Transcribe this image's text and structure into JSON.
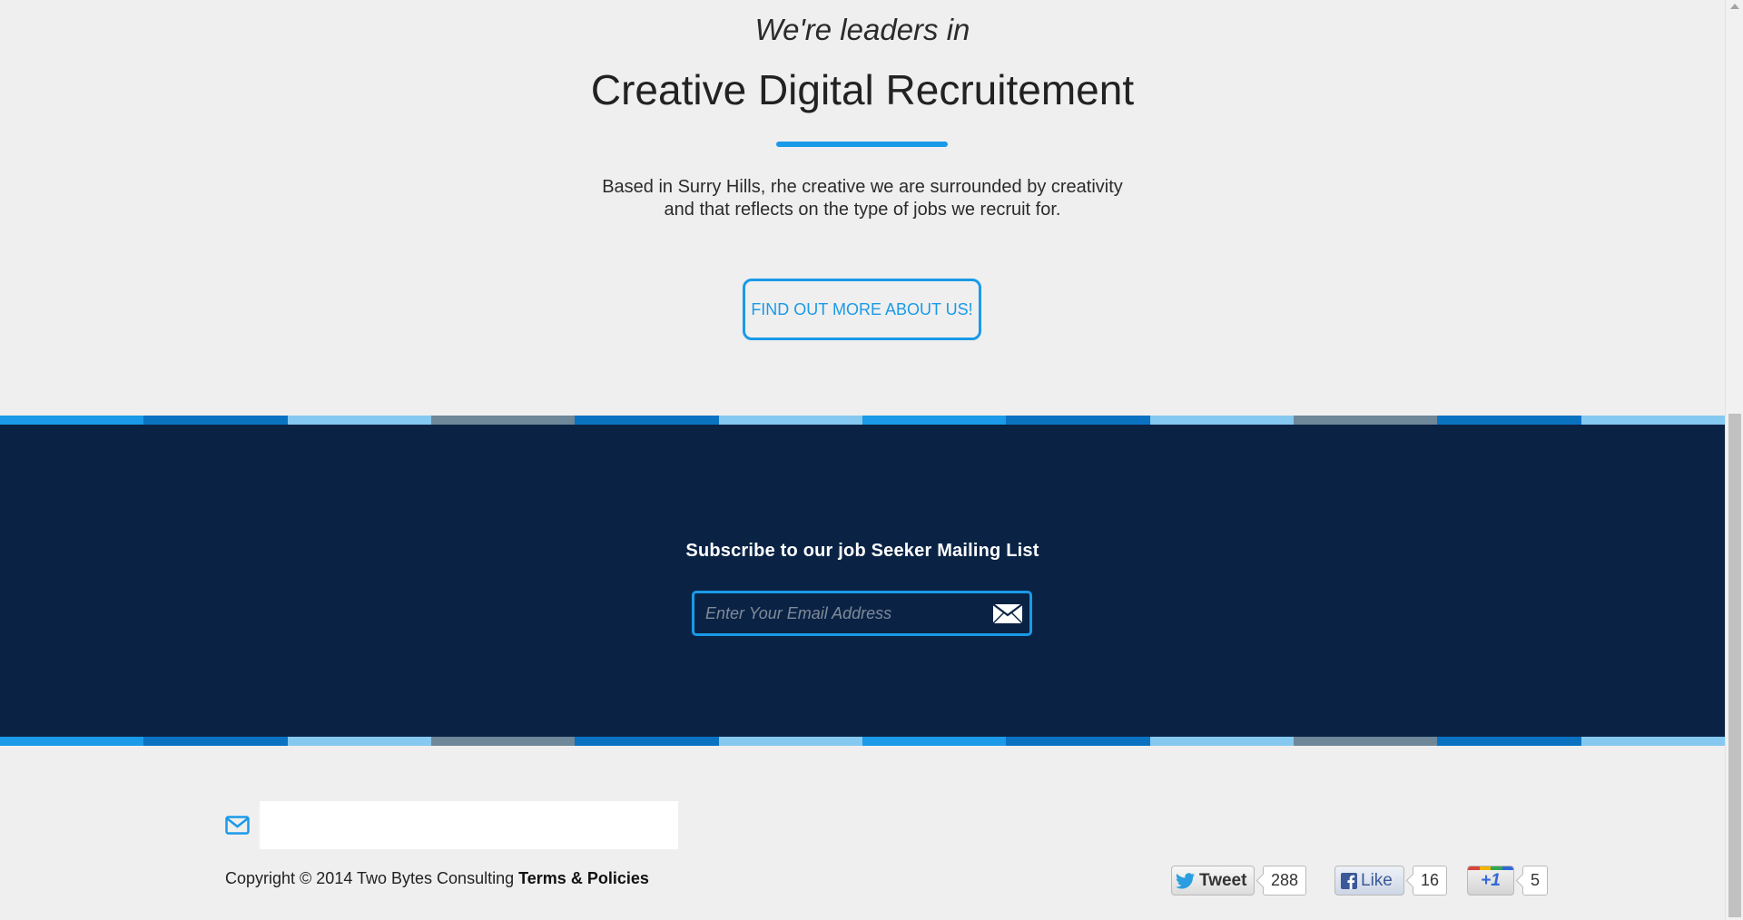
{
  "intro": {
    "kicker": "We're leaders in",
    "title": "Creative Digital Recruitement",
    "text_line1": "Based in Surry Hills, rhe creative we are surrounded by creativity",
    "text_line2": "and that reflects on the type of jobs we recruit for.",
    "cta_label": "FIND OUT MORE ABOUT US!"
  },
  "stripe_colors": [
    "#1a9ae8",
    "#0b72c2",
    "#85c8f0",
    "#6e8799",
    "#0b72c2",
    "#85c8f0",
    "#1a9ae8",
    "#0b72c2",
    "#85c8f0",
    "#6e8799",
    "#0b72c2",
    "#85c8f0"
  ],
  "subscribe": {
    "title": "Subscribe to our job Seeker Mailing List",
    "email_value": "",
    "email_placeholder": "Enter Your Email Address",
    "submit_icon": "envelope-icon"
  },
  "footer": {
    "mail_icon": "envelope-outline-icon",
    "copyright": "Copyright © 2014 Two Bytes Consulting",
    "terms_link": "Terms & Policies"
  },
  "social": {
    "tweet_label": "Tweet",
    "tweet_count": "288",
    "like_label": "Like",
    "like_count": "16",
    "plusone_label": "+1",
    "plusone_count": "5"
  },
  "colors": {
    "accent": "#1a9ae8",
    "band": "#0a2345",
    "background": "#efefef"
  }
}
